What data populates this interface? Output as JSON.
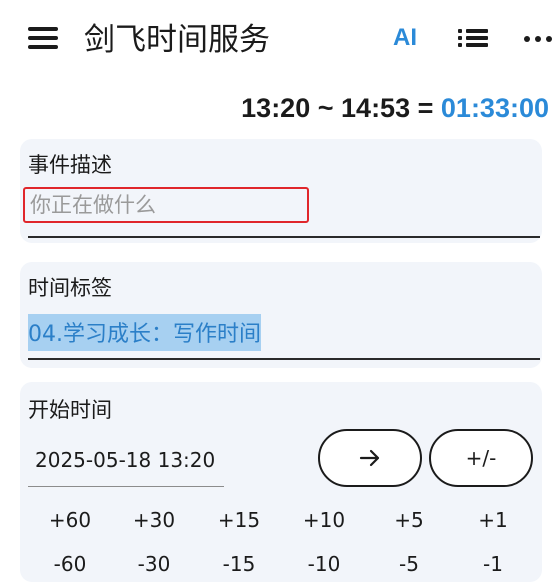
{
  "appbar": {
    "title": "剑飞时间服务",
    "ai_label": "AI",
    "menu_icon": "hamburger-menu-icon",
    "list_icon": "list-icon",
    "more_icon": "more-dots-icon"
  },
  "summary": {
    "start": "13:20",
    "tilde": "~",
    "end": "14:53",
    "equals": "=",
    "duration": "01:33:00"
  },
  "event": {
    "label": "事件描述",
    "placeholder": "你正在做什么",
    "value": ""
  },
  "tag": {
    "label": "时间标签",
    "value": "04.学习成长：写作时间"
  },
  "start": {
    "label": "开始时间",
    "value": "2025-05-18 13:20",
    "arrow_icon": "arrow-right-icon",
    "plusminus_label": "+/-",
    "plus": [
      "+60",
      "+30",
      "+15",
      "+10",
      "+5",
      "+1"
    ],
    "minus": [
      "-60",
      "-30",
      "-15",
      "-10",
      "-5",
      "-1"
    ]
  },
  "colors": {
    "accent": "#2b8ad8",
    "highlight": "#a7d0f1",
    "error_border": "#e0262b",
    "card_bg": "#f2f5fa"
  }
}
